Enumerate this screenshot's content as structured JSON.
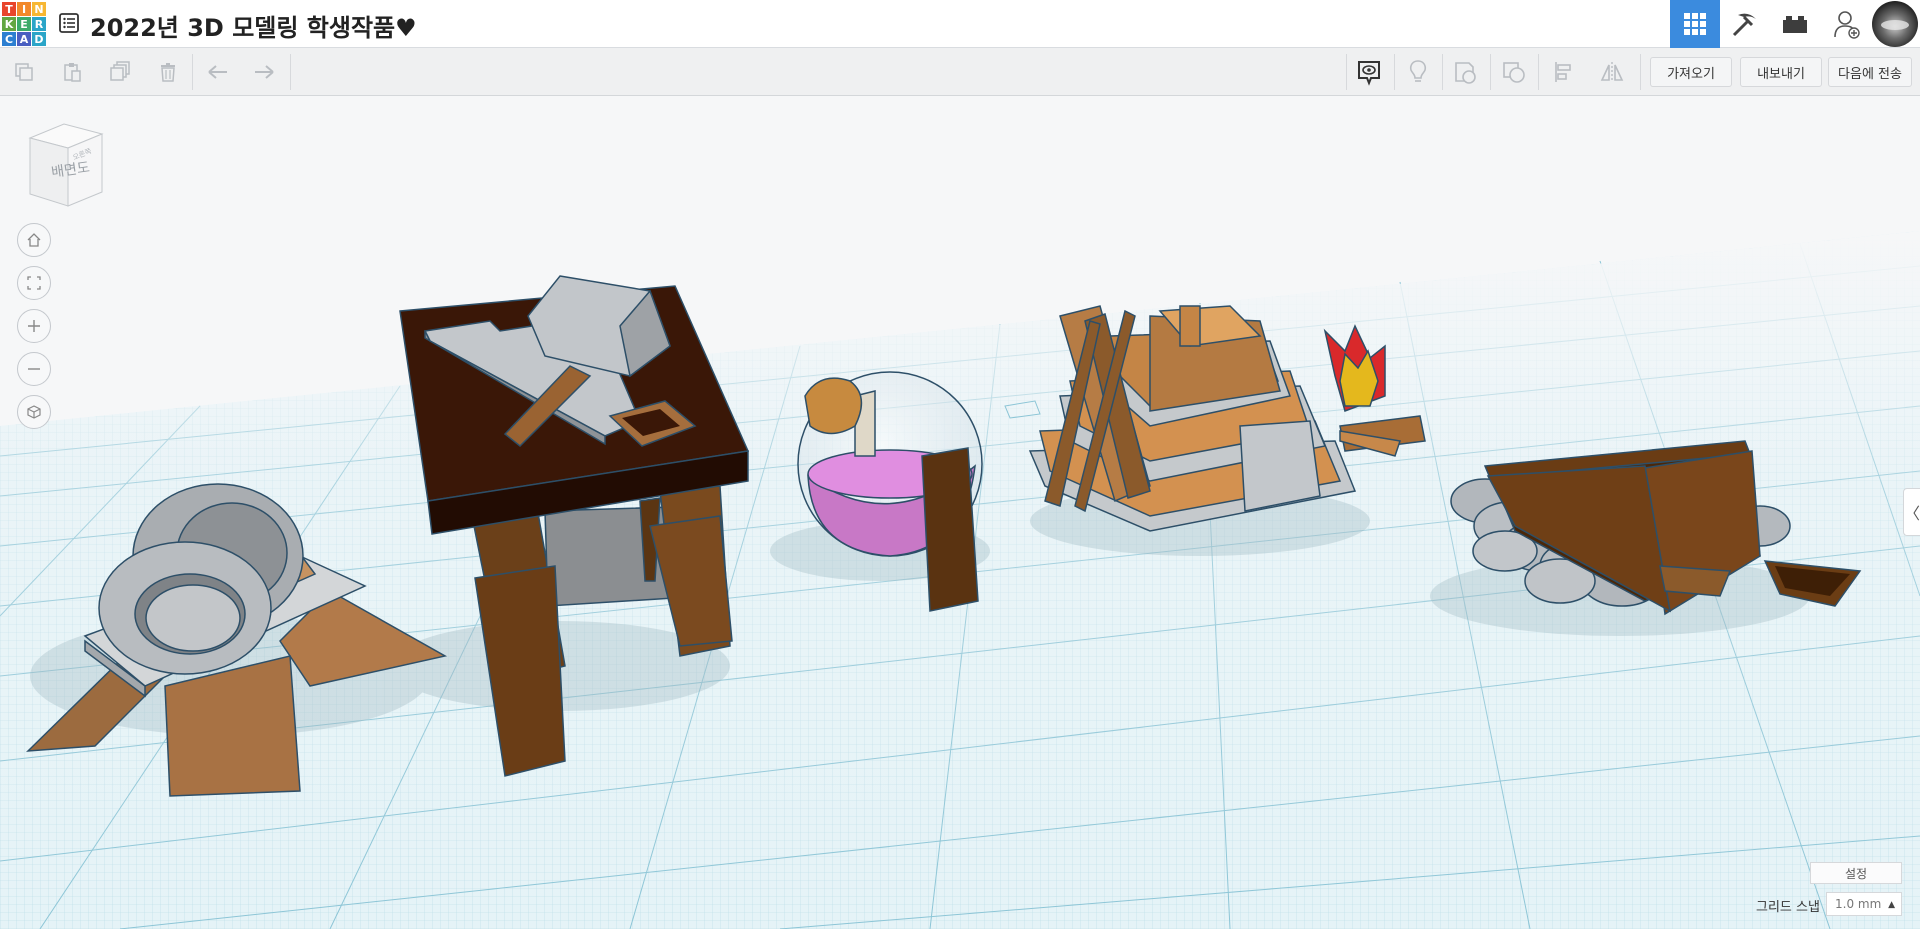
{
  "app": {
    "logo_letters": [
      "T",
      "I",
      "N",
      "K",
      "E",
      "R",
      "C",
      "A",
      "D"
    ],
    "logo_colors": [
      "#e8452c",
      "#f2892b",
      "#f7b733",
      "#63a642",
      "#3cab6a",
      "#2ba5c8",
      "#2c7fd1",
      "#4a5fc1",
      "#2ba5c8"
    ],
    "title": "2022년 3D 모델링 학생작품♥"
  },
  "header": {
    "icons": [
      "grid-view-icon",
      "pickaxe-icon",
      "brick-icon",
      "add-user-icon"
    ],
    "active_index": 0,
    "accent": "#3b8bde"
  },
  "toolbar": {
    "left_icons": [
      "copy-icon",
      "paste-icon",
      "duplicate-icon",
      "delete-icon",
      "undo-icon",
      "redo-icon"
    ],
    "right_icons": [
      "notes-icon",
      "light-icon",
      "shape-icon",
      "group-icon",
      "align-icon",
      "mirror-icon"
    ],
    "import_label": "가져오기",
    "export_label": "내보내기",
    "send_label": "다음에 전송"
  },
  "viewcube": {
    "face_label": "배면도",
    "side_label": "오른쪽"
  },
  "nav_icons": [
    "home-icon",
    "fit-icon",
    "zoom-in-icon",
    "zoom-out-icon",
    "ortho-icon"
  ],
  "bottom": {
    "settings_label": "설정",
    "snap_label": "그리드 스냅",
    "snap_value": "1.0 mm"
  }
}
